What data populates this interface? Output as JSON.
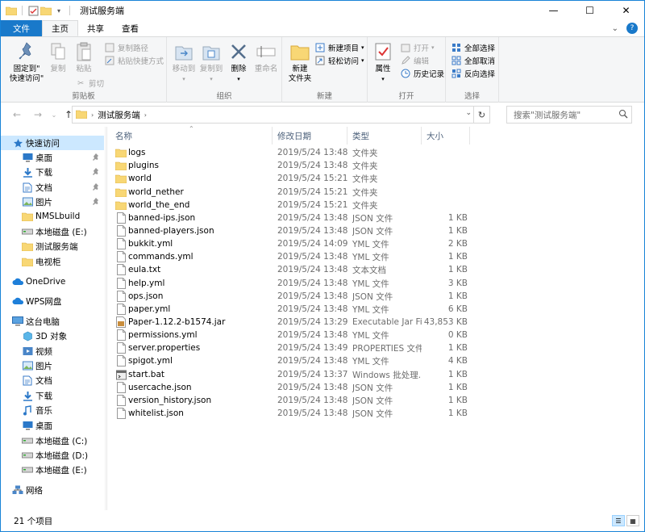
{
  "window": {
    "title": "测试服务端",
    "controls": {
      "minimize": "—",
      "maximize": "☐",
      "close": "✕"
    }
  },
  "ribbon_tabs": [
    {
      "label": "文件"
    },
    {
      "label": "主页"
    },
    {
      "label": "共享"
    },
    {
      "label": "查看"
    }
  ],
  "ribbon": {
    "groups": {
      "clipboard": "剪贴板",
      "organize": "组织",
      "new": "新建",
      "open": "打开",
      "select": "选择"
    },
    "pin_quick_access": "固定到\"\n快速访问\"",
    "copy": "复制",
    "paste": "粘贴",
    "copy_path": "复制路径",
    "paste_shortcut": "粘贴快捷方式",
    "cut": "剪切",
    "move_to": "移动到",
    "copy_to": "复制到",
    "delete": "删除",
    "rename": "重命名",
    "new_folder": "新建\n文件夹",
    "new_item": "新建项目",
    "easy_access": "轻松访问",
    "properties": "属性",
    "open": "打开",
    "edit": "编辑",
    "history": "历史记录",
    "select_all": "全部选择",
    "select_none": "全部取消",
    "invert_selection": "反向选择"
  },
  "address": {
    "path": "测试服务端",
    "search_placeholder": "搜索\"测试服务端\""
  },
  "nav": [
    {
      "label": "快速访问",
      "icon": "star-icon",
      "selected": true
    },
    {
      "label": "桌面",
      "icon": "desktop-icon",
      "pinned": true
    },
    {
      "label": "下载",
      "icon": "download-icon",
      "pinned": true
    },
    {
      "label": "文档",
      "icon": "document-icon",
      "pinned": true
    },
    {
      "label": "图片",
      "icon": "picture-icon",
      "pinned": true
    },
    {
      "label": "NMSLbuild",
      "icon": "folder-icon"
    },
    {
      "label": "本地磁盘 (E:)",
      "icon": "drive-icon"
    },
    {
      "label": "测试服务端",
      "icon": "folder-icon"
    },
    {
      "label": "电视柜",
      "icon": "folder-icon"
    },
    {
      "label": "OneDrive",
      "icon": "cloud-icon"
    },
    {
      "label": "WPS网盘",
      "icon": "cloud-icon"
    },
    {
      "label": "这台电脑",
      "icon": "computer-icon"
    },
    {
      "label": "3D 对象",
      "icon": "cube-icon"
    },
    {
      "label": "视频",
      "icon": "video-icon"
    },
    {
      "label": "图片",
      "icon": "picture-icon"
    },
    {
      "label": "文档",
      "icon": "document-icon"
    },
    {
      "label": "下载",
      "icon": "download-icon"
    },
    {
      "label": "音乐",
      "icon": "music-icon"
    },
    {
      "label": "桌面",
      "icon": "desktop-icon"
    },
    {
      "label": "本地磁盘 (C:)",
      "icon": "drive-icon"
    },
    {
      "label": "本地磁盘 (D:)",
      "icon": "drive-icon"
    },
    {
      "label": "本地磁盘 (E:)",
      "icon": "drive-icon"
    },
    {
      "label": "网络",
      "icon": "network-icon"
    }
  ],
  "columns": {
    "name": "名称",
    "date": "修改日期",
    "type": "类型",
    "size": "大小"
  },
  "files": [
    {
      "name": "logs",
      "date": "2019/5/24 13:48",
      "type": "文件夹",
      "size": "",
      "kind": "folder"
    },
    {
      "name": "plugins",
      "date": "2019/5/24 13:48",
      "type": "文件夹",
      "size": "",
      "kind": "folder"
    },
    {
      "name": "world",
      "date": "2019/5/24 15:21",
      "type": "文件夹",
      "size": "",
      "kind": "folder"
    },
    {
      "name": "world_nether",
      "date": "2019/5/24 15:21",
      "type": "文件夹",
      "size": "",
      "kind": "folder"
    },
    {
      "name": "world_the_end",
      "date": "2019/5/24 15:21",
      "type": "文件夹",
      "size": "",
      "kind": "folder"
    },
    {
      "name": "banned-ips.json",
      "date": "2019/5/24 13:48",
      "type": "JSON 文件",
      "size": "1 KB",
      "kind": "file"
    },
    {
      "name": "banned-players.json",
      "date": "2019/5/24 13:48",
      "type": "JSON 文件",
      "size": "1 KB",
      "kind": "file"
    },
    {
      "name": "bukkit.yml",
      "date": "2019/5/24 14:09",
      "type": "YML 文件",
      "size": "2 KB",
      "kind": "file"
    },
    {
      "name": "commands.yml",
      "date": "2019/5/24 13:48",
      "type": "YML 文件",
      "size": "1 KB",
      "kind": "file"
    },
    {
      "name": "eula.txt",
      "date": "2019/5/24 13:48",
      "type": "文本文档",
      "size": "1 KB",
      "kind": "file"
    },
    {
      "name": "help.yml",
      "date": "2019/5/24 13:48",
      "type": "YML 文件",
      "size": "3 KB",
      "kind": "file"
    },
    {
      "name": "ops.json",
      "date": "2019/5/24 13:48",
      "type": "JSON 文件",
      "size": "1 KB",
      "kind": "file"
    },
    {
      "name": "paper.yml",
      "date": "2019/5/24 13:48",
      "type": "YML 文件",
      "size": "6 KB",
      "kind": "file"
    },
    {
      "name": "Paper-1.12.2-b1574.jar",
      "date": "2019/5/24 13:29",
      "type": "Executable Jar File",
      "size": "43,853 KB",
      "kind": "jar"
    },
    {
      "name": "permissions.yml",
      "date": "2019/5/24 13:48",
      "type": "YML 文件",
      "size": "0 KB",
      "kind": "file"
    },
    {
      "name": "server.properties",
      "date": "2019/5/24 13:49",
      "type": "PROPERTIES 文件",
      "size": "1 KB",
      "kind": "file"
    },
    {
      "name": "spigot.yml",
      "date": "2019/5/24 13:48",
      "type": "YML 文件",
      "size": "4 KB",
      "kind": "file"
    },
    {
      "name": "start.bat",
      "date": "2019/5/24 13:37",
      "type": "Windows 批处理...",
      "size": "1 KB",
      "kind": "bat"
    },
    {
      "name": "usercache.json",
      "date": "2019/5/24 13:48",
      "type": "JSON 文件",
      "size": "1 KB",
      "kind": "file"
    },
    {
      "name": "version_history.json",
      "date": "2019/5/24 13:48",
      "type": "JSON 文件",
      "size": "1 KB",
      "kind": "file"
    },
    {
      "name": "whitelist.json",
      "date": "2019/5/24 13:48",
      "type": "JSON 文件",
      "size": "1 KB",
      "kind": "file"
    }
  ],
  "status": {
    "count": "21 个项目"
  },
  "colors": {
    "accent": "#1979ca",
    "selection": "#cce8ff",
    "folder": "#f8d775"
  }
}
